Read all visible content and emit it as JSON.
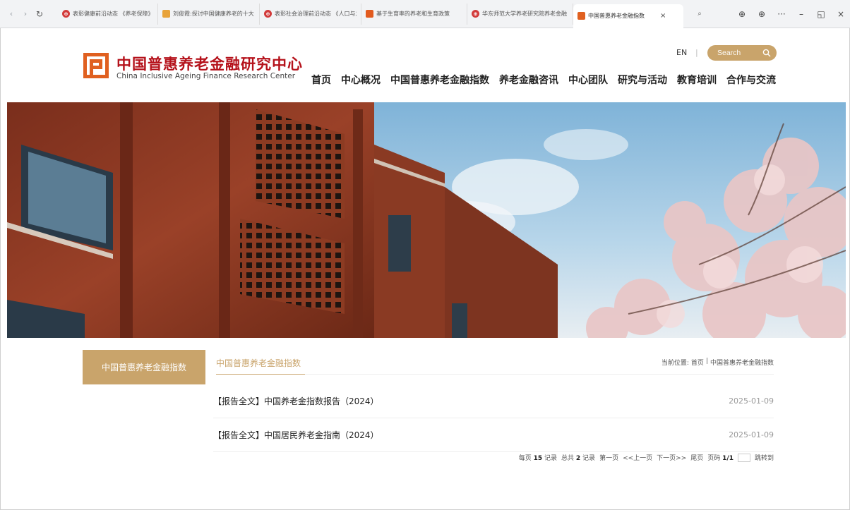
{
  "browser": {
    "tabs": [
      {
        "title": "表彰健康前沿动态 《养老保障》",
        "favicon_color": "#d23a3a"
      },
      {
        "title": "刘俊霞:探讨中国健康养老的十大",
        "favicon_color": "#e8a33a"
      },
      {
        "title": "表彰社会治理前沿动态 《人口与发展》",
        "favicon_color": "#d23a3a"
      },
      {
        "title": "基于生育率的养老和生育政策",
        "favicon_color": "#e25b1f"
      },
      {
        "title": "华东师范大学养老研究院养老金融",
        "favicon_color": "#d23a3a"
      },
      {
        "title": "中国普惠养老金融指数",
        "favicon_color": "#e06020",
        "active": true
      }
    ],
    "close_glyph": "×",
    "window_controls": [
      "⊕",
      "⊕",
      "···",
      "–",
      "◱",
      "×"
    ]
  },
  "header": {
    "logo_cn": "中国普惠养老金融研究中心",
    "logo_en": "China Inclusive Ageing Finance Research Center",
    "lang_label": "EN",
    "lang_sep": "|",
    "search_placeholder": "Search",
    "nav": [
      "首页",
      "中心概况",
      "中国普惠养老金融指数",
      "养老金融咨讯",
      "中心团队",
      "研究与活动",
      "教育培训",
      "合作与交流"
    ]
  },
  "colors": {
    "brand_red": "#b5121b",
    "gold": "#c9a46b",
    "logo_orange": "#e06020"
  },
  "content": {
    "side_label": "中国普惠养老金融指数",
    "section_title": "中国普惠养老金融指数",
    "breadcrumb_prefix": "当前位置:",
    "breadcrumb_home": "首页",
    "breadcrumb_sep": "|",
    "breadcrumb_current": "中国普惠养老金融指数",
    "articles": [
      {
        "title": "【报告全文】中国养老金指数报告（2024）",
        "date": "2025-01-09"
      },
      {
        "title": "【报告全文】中国居民养老金指南（2024）",
        "date": "2025-01-09"
      }
    ],
    "pager": {
      "per_page_prefix": "每页",
      "per_page": "15",
      "per_page_suffix": "记录",
      "total_prefix": "总共",
      "total": "2",
      "total_suffix": "记录",
      "first": "第一页",
      "prev": "<<上一页",
      "next": "下一页>>",
      "last": "尾页",
      "page_prefix": "页码",
      "page": "1/1",
      "jump": "跳转到"
    }
  }
}
